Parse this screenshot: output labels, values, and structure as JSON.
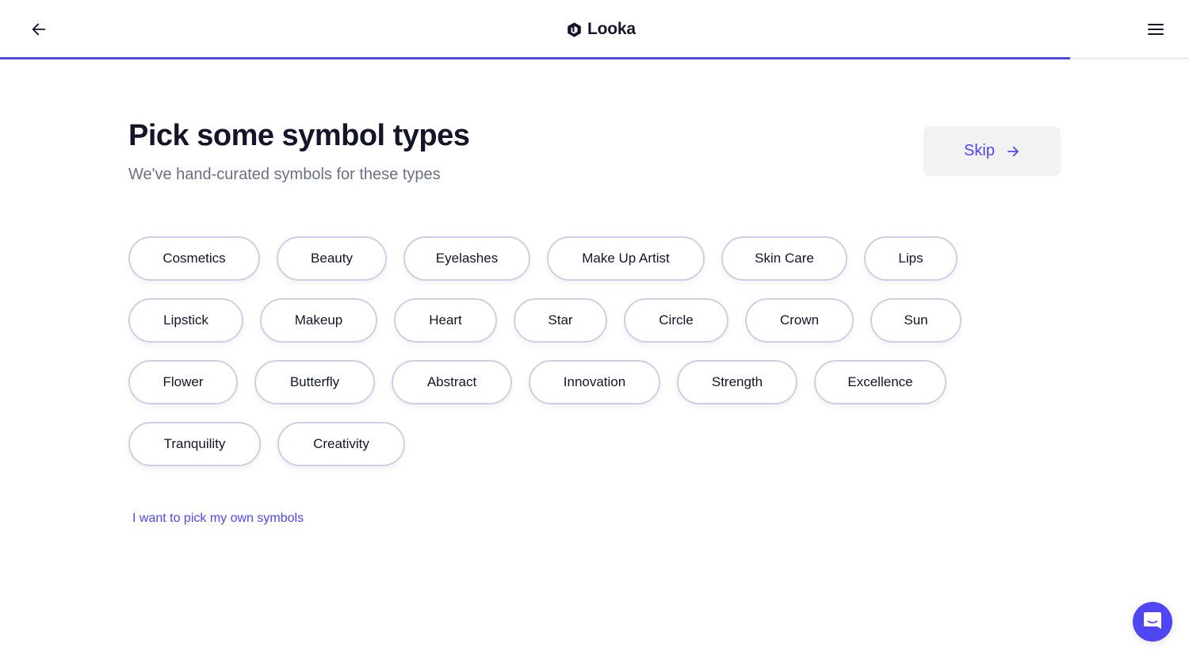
{
  "header": {
    "back_icon": "arrow-left-icon",
    "logo_icon": "looka-hexagon-icon",
    "logo_text": "Looka",
    "menu_icon": "hamburger-menu-icon",
    "progress_fraction": 0.9,
    "accent_color": "#5046f3"
  },
  "main": {
    "title": "Pick some symbol types",
    "subtitle": "We've hand-curated symbols for these types",
    "skip_button": {
      "label": "Skip",
      "icon": "arrow-right-icon"
    },
    "chip_rows": [
      [
        "Cosmetics",
        "Beauty",
        "Eyelashes",
        "Make Up Artist",
        "Skin Care",
        "Lips"
      ],
      [
        "Lipstick",
        "Makeup",
        "Heart",
        "Star",
        "Circle",
        "Crown",
        "Sun"
      ],
      [
        "Flower",
        "Butterfly",
        "Abstract",
        "Innovation",
        "Strength",
        "Excellence"
      ],
      [
        "Tranquility",
        "Creativity"
      ]
    ],
    "own_symbols_link": "I want to pick my own symbols"
  },
  "chat_widget": {
    "icon": "chat-bubble-icon"
  }
}
